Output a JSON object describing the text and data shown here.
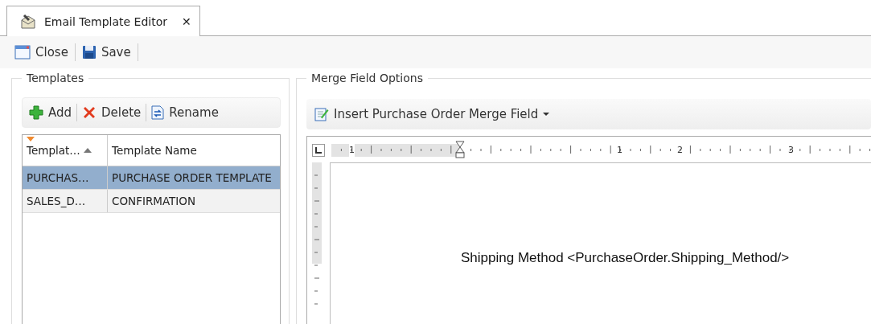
{
  "tab": {
    "title": "Email Template Editor",
    "close": "✕",
    "selected": true
  },
  "toolbar": [
    {
      "kind": "close",
      "label": "Close"
    },
    {
      "kind": "save",
      "label": "Save"
    }
  ],
  "templates": {
    "title": "Templates",
    "actions": [
      {
        "kind": "add",
        "label": "Add"
      },
      {
        "kind": "delete",
        "label": "Delete"
      },
      {
        "kind": "rename",
        "label": "Rename"
      }
    ],
    "columns": [
      {
        "label": "Templat…",
        "sorted": true
      },
      {
        "label": "Template Name",
        "sorted": false
      }
    ],
    "rows": [
      {
        "cells": [
          "PURCHAS…",
          "PURCHASE ORDER TEMPLATE"
        ],
        "selected": true
      },
      {
        "cells": [
          "SALES_D…",
          "CONFIRMATION"
        ],
        "selected": false
      }
    ]
  },
  "merge": {
    "title": "Merge Field Options",
    "insert_button": "Insert Purchase Order Merge Field",
    "ruler_labels": [
      "1",
      "1",
      "2",
      "3"
    ],
    "document_text": "Shipping Method <PurchaseOrder.Shipping_Method/>"
  }
}
